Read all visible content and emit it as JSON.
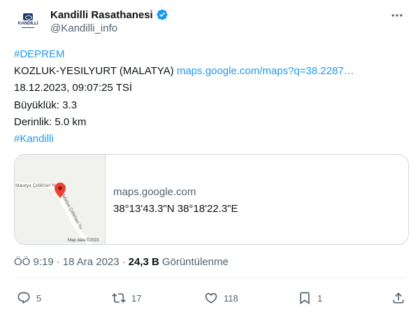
{
  "author": {
    "display_name": "Kandilli Rasathanesi",
    "handle": "@Kandilli_info",
    "avatar_text": "KANDİLLİ",
    "verified": true,
    "accent_color": "#1d9bf0"
  },
  "tweet": {
    "line1": "#DEPREM",
    "line2_text": "KOZLUK-YESILYURT (MALATYA) ",
    "line2_link": "maps.google.com/maps?q=38.2287…",
    "line3": "18.12.2023, 09:07:25 TSİ",
    "line4": "Büyüklük: 3.3",
    "line5": "Derinlik: 5.0 km",
    "line6": "#Kandilli"
  },
  "card": {
    "map_road_label_top": "Malatya Çelikhan Yo",
    "map_road_label_diag": "Malatya Çelikhan Yo",
    "map_attribution": "Map data ©2023",
    "domain": "maps.google.com",
    "title": "38°13'43.3\"N 38°18'22.3\"E"
  },
  "meta": {
    "time": "ÖÖ 9:19",
    "separator": "·",
    "date": "18 Ara 2023",
    "views_count": "24,3 B",
    "views_label": "Görüntülenme"
  },
  "actions": {
    "reply_count": "5",
    "retweet_count": "17",
    "like_count": "118",
    "bookmark_count": "1",
    "icon_color": "#536471"
  }
}
